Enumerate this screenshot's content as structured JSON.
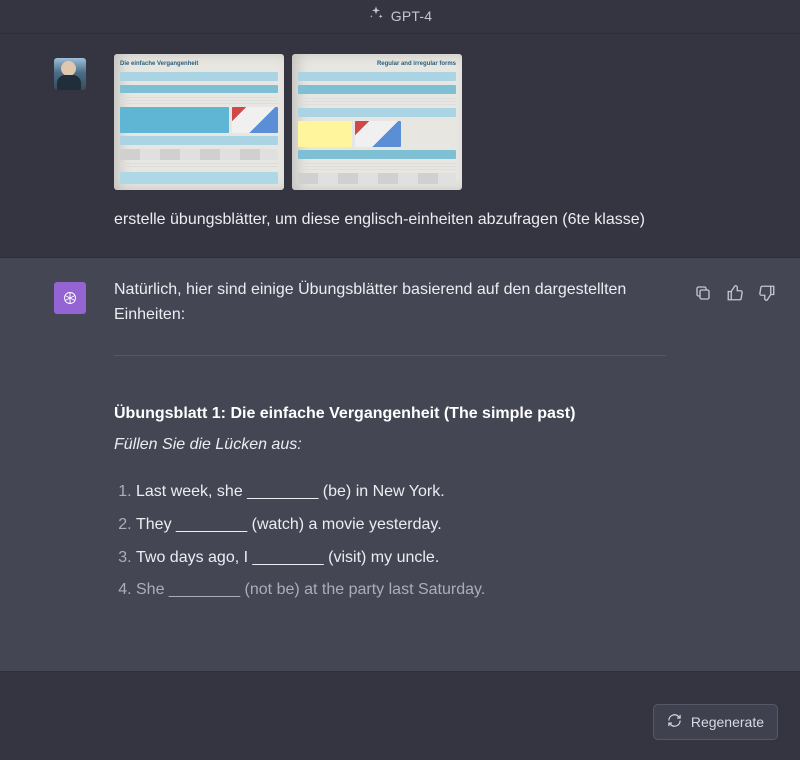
{
  "header": {
    "title": "GPT-4"
  },
  "user": {
    "prompt": "erstelle übungsblätter, um diese englisch-einheiten abzufragen (6te klasse)"
  },
  "assistant": {
    "intro": "Natürlich, hier sind einige Übungsblätter basierend auf den dargestellten Einheiten:",
    "sheet1": {
      "title": "Übungsblatt 1: Die einfache Vergangenheit (The simple past)",
      "subtitle": "Füllen Sie die Lücken aus:",
      "items": [
        "Last week, she ________ (be) in New York.",
        "They ________ (watch) a movie yesterday.",
        "Two days ago, I ________ (visit) my uncle.",
        "She ________ (not be) at the party last Saturday."
      ]
    }
  },
  "actions": {
    "regenerate_label": "Regenerate"
  }
}
